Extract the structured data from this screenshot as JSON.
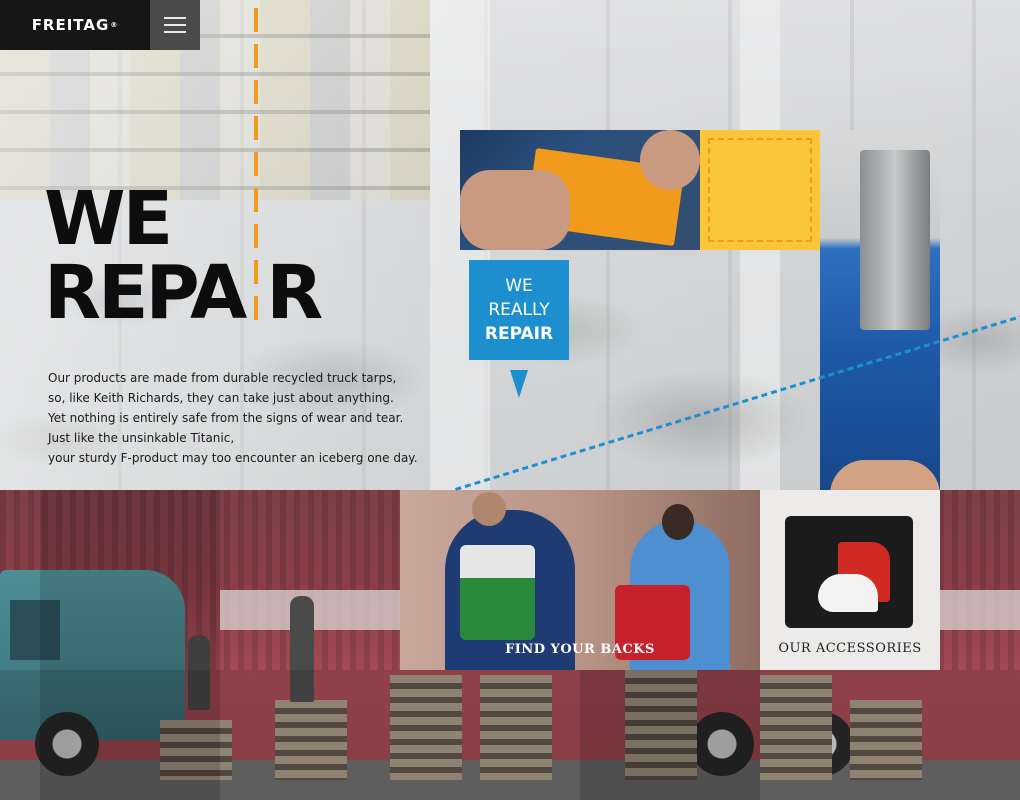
{
  "header": {
    "logo_text": "FREITAG",
    "logo_mark": "®"
  },
  "hero": {
    "headline_line1": "WE",
    "headline_line2_a": "REPA",
    "headline_line2_b": "R",
    "body": [
      "Our products are made from durable recycled truck tarps,",
      "so, like Keith Richards, they can take just about anything.",
      "Yet nothing is entirely safe from the signs of wear and tear.",
      "Just like the unsinkable Titanic,",
      "your sturdy F-product may too encounter an iceberg one day."
    ],
    "badge_line1": "WE",
    "badge_line2": "REALLY",
    "badge_line3": "REPAIR"
  },
  "tiles": {
    "find_label": "FIND YOUR BACKS",
    "accessories_label": "OUR ACCESSORIES"
  },
  "colors": {
    "accent_blue": "#1d8fcf",
    "accent_orange": "#f29a1b",
    "accent_yellow": "#fcc63a"
  },
  "icons": {
    "menu": "hamburger-icon",
    "badge_arrow": "triangle-down-icon"
  }
}
